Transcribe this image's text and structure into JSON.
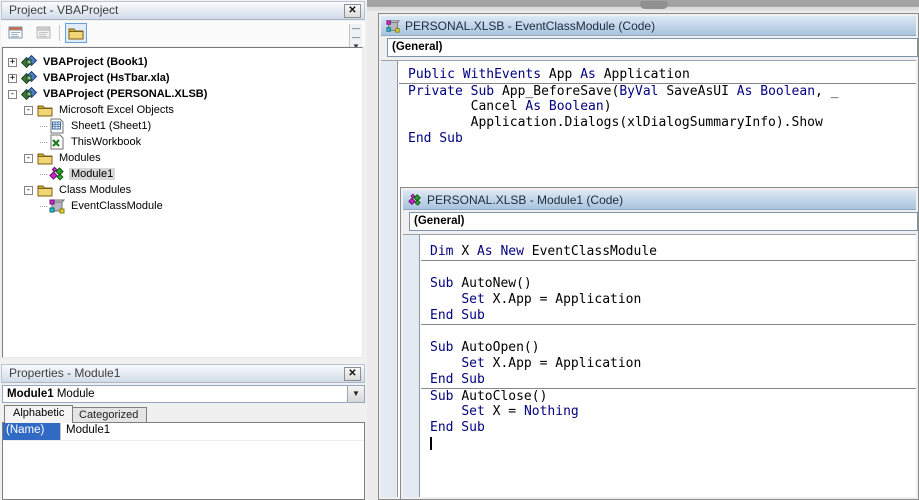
{
  "colors": {
    "keyword": "#000080",
    "plain": "#000000",
    "selection": "#316ac5",
    "titlebar_blue": "#a9c4dd"
  },
  "project_panel": {
    "title": "Project - VBAProject",
    "close_label": "x",
    "toolbar": {
      "view_code": "view-code",
      "view_object": "view-object",
      "toggle_folders": "toggle-folders"
    },
    "tree": [
      {
        "label": "VBAProject (Book1)",
        "depth": 0,
        "expander": "+",
        "icon": "project",
        "bold": true,
        "selected": false
      },
      {
        "label": "VBAProject (HsTbar.xla)",
        "depth": 0,
        "expander": "+",
        "icon": "project",
        "bold": true,
        "selected": false
      },
      {
        "label": "VBAProject (PERSONAL.XLSB)",
        "depth": 0,
        "expander": "-",
        "icon": "project",
        "bold": true,
        "selected": false
      },
      {
        "label": "Microsoft Excel Objects",
        "depth": 1,
        "expander": "-",
        "icon": "folder",
        "bold": false,
        "selected": false
      },
      {
        "label": "Sheet1 (Sheet1)",
        "depth": 2,
        "expander": "",
        "icon": "sheet",
        "bold": false,
        "selected": false
      },
      {
        "label": "ThisWorkbook",
        "depth": 2,
        "expander": "",
        "icon": "workbook",
        "bold": false,
        "selected": false
      },
      {
        "label": "Modules",
        "depth": 1,
        "expander": "-",
        "icon": "folder",
        "bold": false,
        "selected": false
      },
      {
        "label": "Module1",
        "depth": 2,
        "expander": "",
        "icon": "module",
        "bold": false,
        "selected": true
      },
      {
        "label": "Class Modules",
        "depth": 1,
        "expander": "-",
        "icon": "folder",
        "bold": false,
        "selected": false
      },
      {
        "label": "EventClassModule",
        "depth": 2,
        "expander": "",
        "icon": "class",
        "bold": false,
        "selected": false
      }
    ]
  },
  "properties_panel": {
    "title": "Properties - Module1",
    "close_label": "x",
    "object_name": "Module1",
    "object_type": "Module",
    "dropdown_arrow": "▼",
    "tabs": {
      "alphabetic": "Alphabetic",
      "categorized": "Categorized"
    },
    "rows": [
      {
        "name": "(Name)",
        "value": "Module1"
      }
    ]
  },
  "window1": {
    "title": "PERSONAL.XLSB - EventClassModule (Code)",
    "icon": "class",
    "dropdown": "(General)",
    "code": [
      {
        "sep": false,
        "caret": false,
        "seg": [
          [
            "Public ",
            1
          ],
          [
            "WithEvents ",
            1
          ],
          [
            "App ",
            0
          ],
          [
            "As ",
            1
          ],
          [
            "Application",
            0
          ]
        ]
      },
      {
        "sep": true,
        "caret": false,
        "seg": [
          [
            "Private ",
            1
          ],
          [
            "Sub ",
            1
          ],
          [
            "App_BeforeSave(",
            0
          ],
          [
            "ByVal ",
            1
          ],
          [
            "SaveAsUI ",
            0
          ],
          [
            "As ",
            1
          ],
          [
            "Boolean",
            1
          ],
          [
            ", _",
            0
          ]
        ]
      },
      {
        "sep": false,
        "caret": false,
        "seg": [
          [
            "        Cancel ",
            0
          ],
          [
            "As ",
            1
          ],
          [
            "Boolean",
            1
          ],
          [
            ")",
            0
          ]
        ]
      },
      {
        "sep": false,
        "caret": false,
        "seg": [
          [
            "        Application.Dialogs(xlDialogSummaryInfo).Show",
            0
          ]
        ]
      },
      {
        "sep": false,
        "caret": false,
        "seg": [
          [
            "End Sub",
            1
          ]
        ]
      }
    ]
  },
  "window2": {
    "title": "PERSONAL.XLSB - Module1 (Code)",
    "icon": "module",
    "dropdown": "(General)",
    "code": [
      {
        "sep": false,
        "caret": false,
        "seg": [
          [
            "Dim ",
            1
          ],
          [
            "X ",
            0
          ],
          [
            "As ",
            1
          ],
          [
            "New ",
            1
          ],
          [
            "EventClassModule",
            0
          ]
        ]
      },
      {
        "sep": true,
        "caret": false,
        "seg": []
      },
      {
        "sep": false,
        "caret": false,
        "seg": [
          [
            "Sub ",
            1
          ],
          [
            "AutoNew()",
            0
          ]
        ]
      },
      {
        "sep": false,
        "caret": false,
        "seg": [
          [
            "    ",
            0
          ],
          [
            "Set ",
            1
          ],
          [
            "X.App = Application",
            0
          ]
        ]
      },
      {
        "sep": false,
        "caret": false,
        "seg": [
          [
            "End Sub",
            1
          ]
        ]
      },
      {
        "sep": true,
        "caret": false,
        "seg": []
      },
      {
        "sep": false,
        "caret": false,
        "seg": [
          [
            "Sub ",
            1
          ],
          [
            "AutoOpen()",
            0
          ]
        ]
      },
      {
        "sep": false,
        "caret": false,
        "seg": [
          [
            "    ",
            0
          ],
          [
            "Set ",
            1
          ],
          [
            "X.App = Application",
            0
          ]
        ]
      },
      {
        "sep": false,
        "caret": false,
        "seg": [
          [
            "End Sub",
            1
          ]
        ]
      },
      {
        "sep": true,
        "caret": false,
        "seg": [
          [
            "Sub ",
            1
          ],
          [
            "AutoClose()",
            0
          ]
        ]
      },
      {
        "sep": false,
        "caret": false,
        "seg": [
          [
            "    ",
            0
          ],
          [
            "Set ",
            1
          ],
          [
            "X = ",
            0
          ],
          [
            "Nothing",
            1
          ]
        ]
      },
      {
        "sep": false,
        "caret": false,
        "seg": [
          [
            "End Sub",
            1
          ]
        ]
      },
      {
        "sep": false,
        "caret": true,
        "seg": []
      }
    ]
  }
}
